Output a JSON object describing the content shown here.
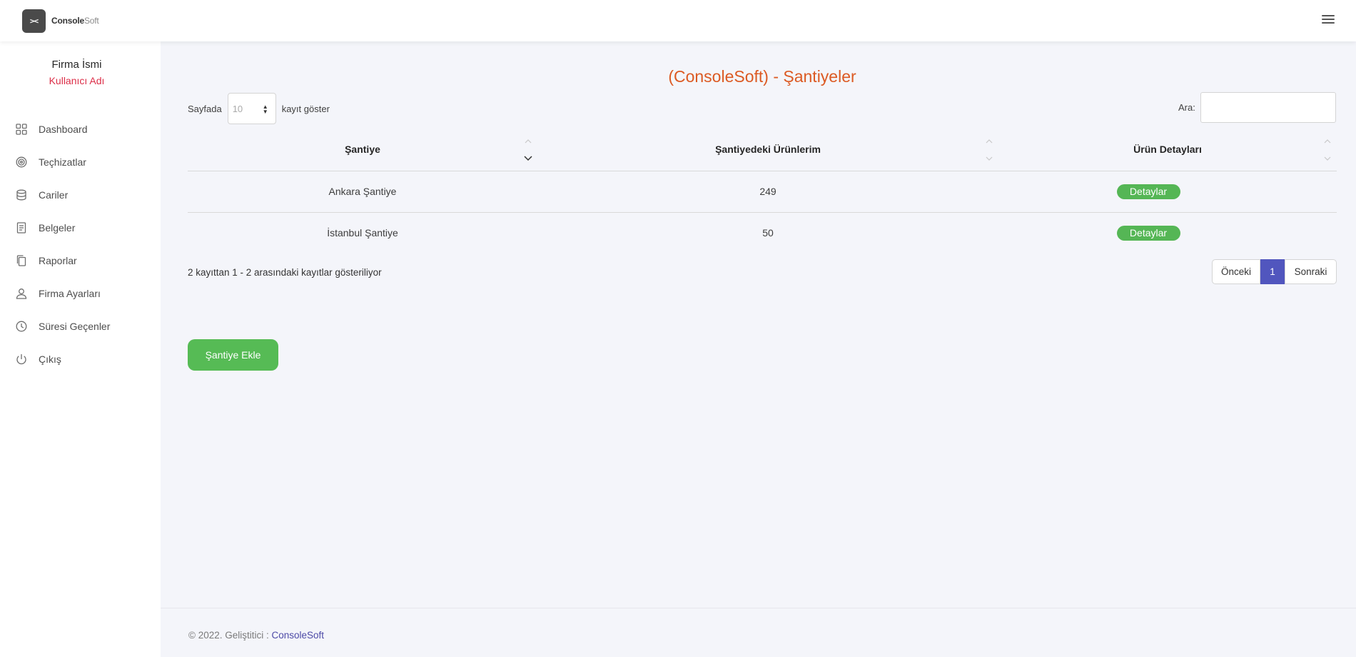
{
  "brand": {
    "logo_mark": "><",
    "name_bold": "Console",
    "name_light": "Soft"
  },
  "sidebar": {
    "company": "Firma İsmi",
    "user": "Kullanıcı Adı",
    "items": [
      {
        "label": "Dashboard",
        "icon": "grid-icon"
      },
      {
        "label": "Teçhizatlar",
        "icon": "target-icon"
      },
      {
        "label": "Cariler",
        "icon": "database-icon"
      },
      {
        "label": "Belgeler",
        "icon": "document-icon"
      },
      {
        "label": "Raporlar",
        "icon": "copy-icon"
      },
      {
        "label": "Firma Ayarları",
        "icon": "user-icon"
      },
      {
        "label": "Süresi Geçenler",
        "icon": "clock-icon"
      },
      {
        "label": "Çıkış",
        "icon": "power-icon"
      }
    ]
  },
  "main": {
    "title": "(ConsoleSoft) - Şantiyeler",
    "length": {
      "prefix": "Sayfada",
      "value": "10",
      "suffix": "kayıt göster"
    },
    "search": {
      "label": "Ara:",
      "value": ""
    },
    "table": {
      "headers": [
        "Şantiye",
        "Şantiyedeki Ürünlerim",
        "Ürün Detayları"
      ],
      "rows": [
        {
          "name": "Ankara Şantiye",
          "count": "249",
          "action": "Detaylar"
        },
        {
          "name": "İstanbul Şantiye",
          "count": "50",
          "action": "Detaylar"
        }
      ]
    },
    "info": "2 kayıttan 1 - 2 arasındaki kayıtlar gösteriliyor",
    "pagination": {
      "prev": "Önceki",
      "current": "1",
      "next": "Sonraki"
    },
    "add_button": "Şantiye Ekle"
  },
  "footer": {
    "text": "© 2022. Geliştitici :",
    "developer": "ConsoleSoft"
  },
  "colors": {
    "accent": "#5156be",
    "success": "#55b655",
    "title": "#dc5a23",
    "user": "#dc2d47"
  }
}
